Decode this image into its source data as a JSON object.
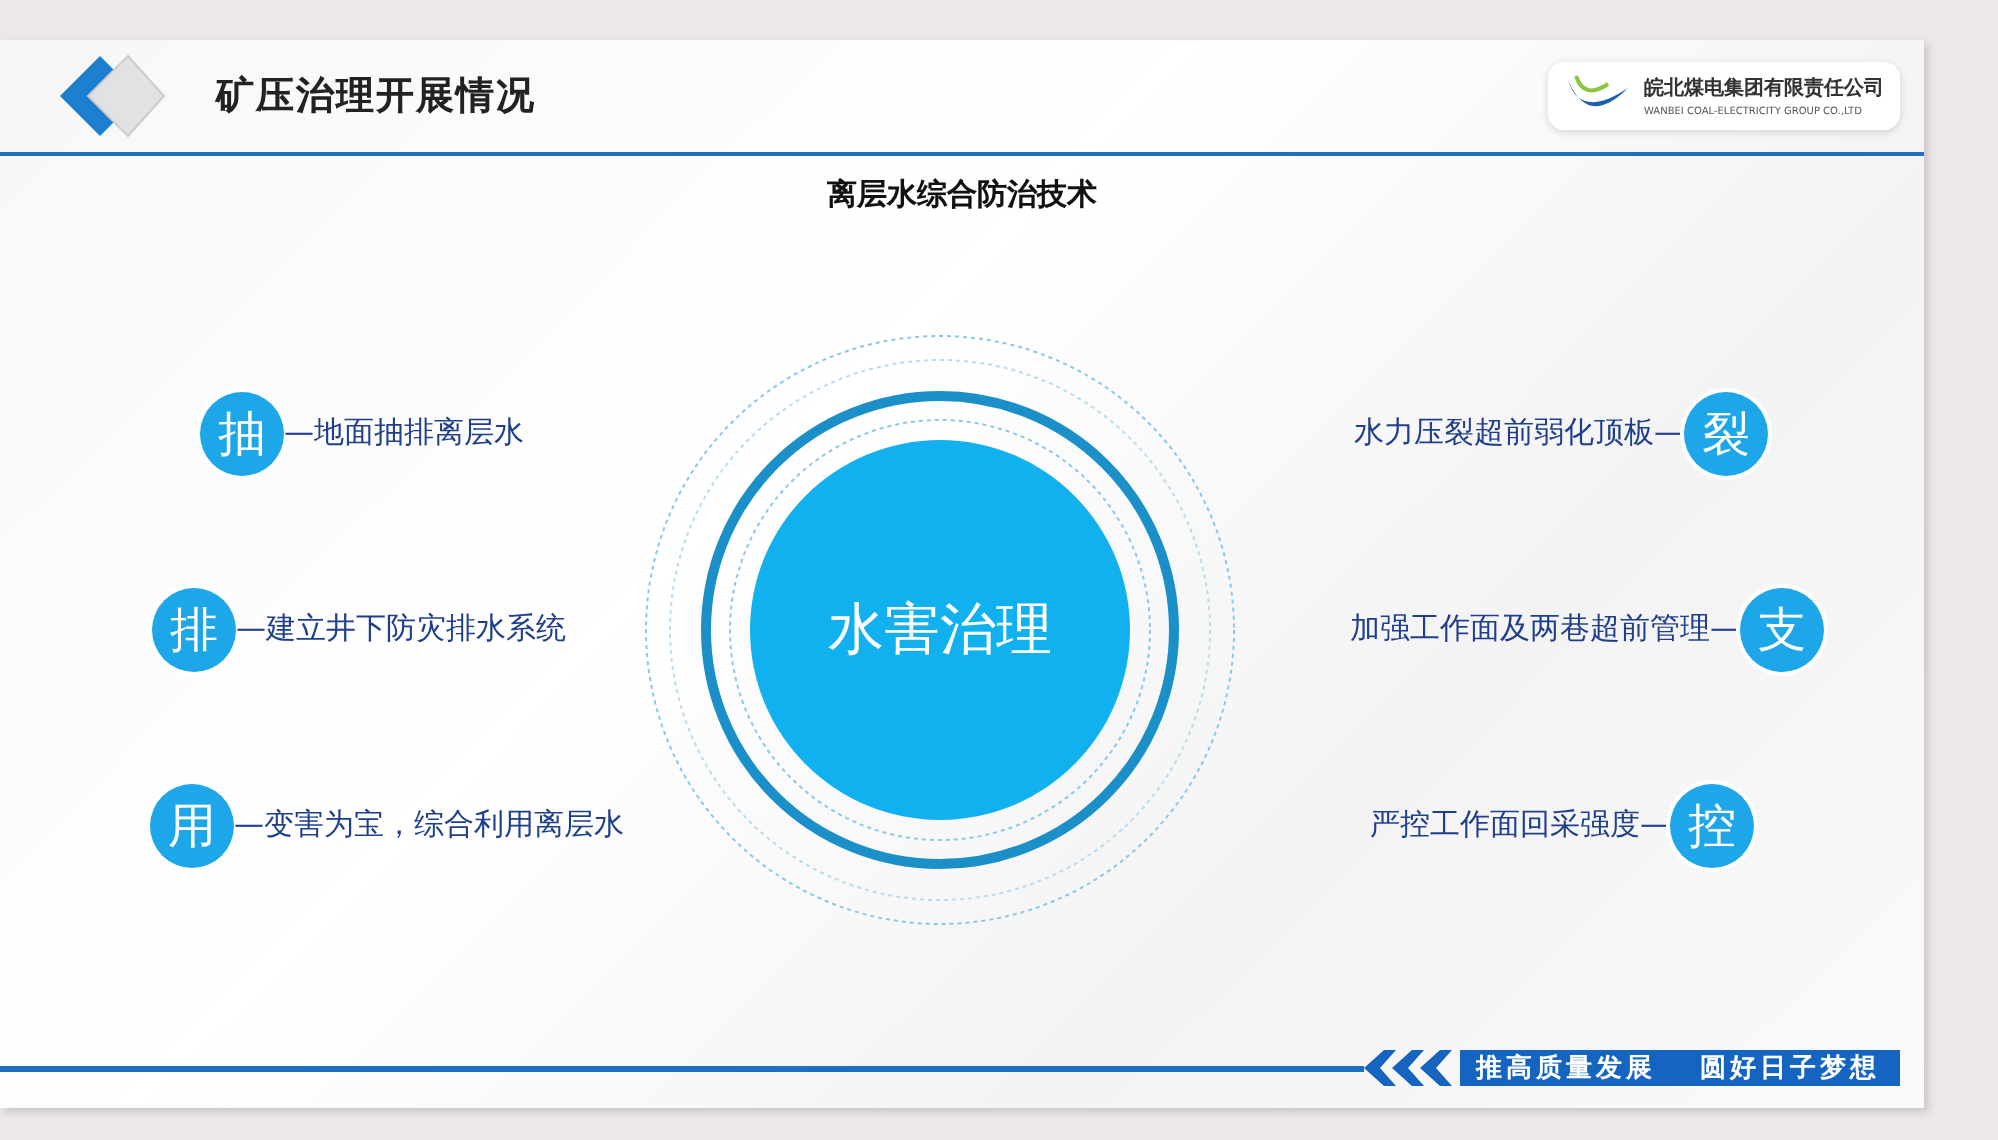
{
  "header": {
    "title": "矿压治理开展情况",
    "logo": {
      "name": "皖北煤电集团有限责任公司",
      "english": "WANBEI COAL-ELECTRICITY GROUP CO.,LTD"
    }
  },
  "subtitle": "离层水综合防治技术",
  "center": "水害治理",
  "left_items": [
    {
      "badge": "抽",
      "text": "—地面抽排离层水"
    },
    {
      "badge": "排",
      "text": "—建立井下防灾排水系统"
    },
    {
      "badge": "用",
      "text": "—变害为宝，综合利用离层水"
    }
  ],
  "right_items": [
    {
      "badge": "裂",
      "text": "水力压裂超前弱化顶板—"
    },
    {
      "badge": "支",
      "text": "加强工作面及两巷超前管理—"
    },
    {
      "badge": "控",
      "text": "严控工作面回采强度—"
    }
  ],
  "footer": {
    "slogans": [
      "推高质量发展",
      "圆好日子梦想"
    ]
  }
}
